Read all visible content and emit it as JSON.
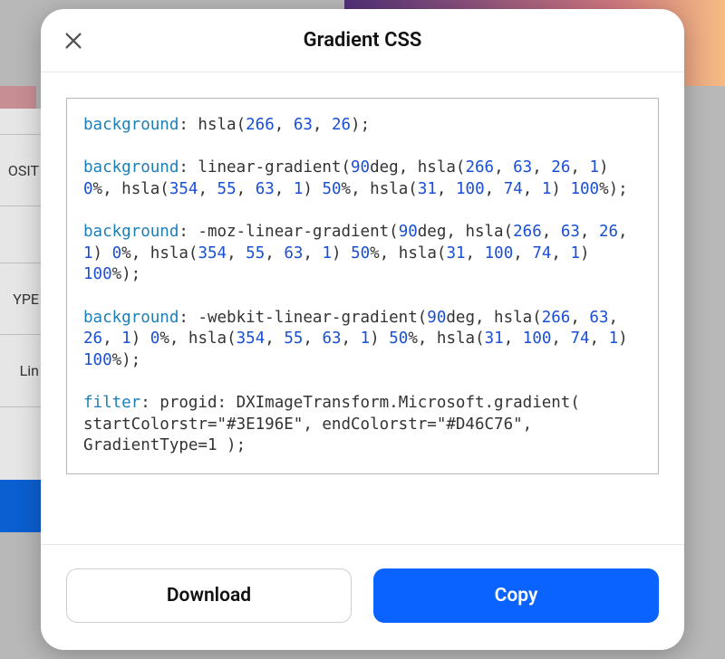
{
  "background": {
    "labels": {
      "osit": "OSIT",
      "ype": "YPE",
      "lin": "Lin"
    }
  },
  "modal": {
    "title": "Gradient CSS"
  },
  "code": {
    "lines": [
      [
        {
          "t": "background",
          "c": "prop"
        },
        {
          "t": ": hsla(",
          "c": ""
        },
        {
          "t": "266",
          "c": "num"
        },
        {
          "t": ", ",
          "c": ""
        },
        {
          "t": "63",
          "c": "num"
        },
        {
          "t": ", ",
          "c": ""
        },
        {
          "t": "26",
          "c": "num"
        },
        {
          "t": ");",
          "c": ""
        }
      ],
      [],
      [
        {
          "t": "background",
          "c": "prop"
        },
        {
          "t": ": linear-gradient(",
          "c": ""
        },
        {
          "t": "90",
          "c": "num"
        },
        {
          "t": "deg, hsla(",
          "c": ""
        },
        {
          "t": "266",
          "c": "num"
        },
        {
          "t": ", ",
          "c": ""
        },
        {
          "t": "63",
          "c": "num"
        },
        {
          "t": ", ",
          "c": ""
        },
        {
          "t": "26",
          "c": "num"
        },
        {
          "t": ", ",
          "c": ""
        },
        {
          "t": "1",
          "c": "num"
        },
        {
          "t": ") ",
          "c": ""
        },
        {
          "t": "0",
          "c": "num"
        },
        {
          "t": "%, hsla(",
          "c": ""
        },
        {
          "t": "354",
          "c": "num"
        },
        {
          "t": ", ",
          "c": ""
        },
        {
          "t": "55",
          "c": "num"
        },
        {
          "t": ", ",
          "c": ""
        },
        {
          "t": "63",
          "c": "num"
        },
        {
          "t": ", ",
          "c": ""
        },
        {
          "t": "1",
          "c": "num"
        },
        {
          "t": ") ",
          "c": ""
        },
        {
          "t": "50",
          "c": "num"
        },
        {
          "t": "%, hsla(",
          "c": ""
        },
        {
          "t": "31",
          "c": "num"
        },
        {
          "t": ", ",
          "c": ""
        },
        {
          "t": "100",
          "c": "num"
        },
        {
          "t": ", ",
          "c": ""
        },
        {
          "t": "74",
          "c": "num"
        },
        {
          "t": ", ",
          "c": ""
        },
        {
          "t": "1",
          "c": "num"
        },
        {
          "t": ") ",
          "c": ""
        },
        {
          "t": "100",
          "c": "num"
        },
        {
          "t": "%);",
          "c": ""
        }
      ],
      [],
      [
        {
          "t": "background",
          "c": "prop"
        },
        {
          "t": ": -moz-linear-gradient(",
          "c": ""
        },
        {
          "t": "90",
          "c": "num"
        },
        {
          "t": "deg, hsla(",
          "c": ""
        },
        {
          "t": "266",
          "c": "num"
        },
        {
          "t": ", ",
          "c": ""
        },
        {
          "t": "63",
          "c": "num"
        },
        {
          "t": ", ",
          "c": ""
        },
        {
          "t": "26",
          "c": "num"
        },
        {
          "t": ", ",
          "c": ""
        },
        {
          "t": "1",
          "c": "num"
        },
        {
          "t": ") ",
          "c": ""
        },
        {
          "t": "0",
          "c": "num"
        },
        {
          "t": "%, hsla(",
          "c": ""
        },
        {
          "t": "354",
          "c": "num"
        },
        {
          "t": ", ",
          "c": ""
        },
        {
          "t": "55",
          "c": "num"
        },
        {
          "t": ", ",
          "c": ""
        },
        {
          "t": "63",
          "c": "num"
        },
        {
          "t": ", ",
          "c": ""
        },
        {
          "t": "1",
          "c": "num"
        },
        {
          "t": ") ",
          "c": ""
        },
        {
          "t": "50",
          "c": "num"
        },
        {
          "t": "%, hsla(",
          "c": ""
        },
        {
          "t": "31",
          "c": "num"
        },
        {
          "t": ", ",
          "c": ""
        },
        {
          "t": "100",
          "c": "num"
        },
        {
          "t": ", ",
          "c": ""
        },
        {
          "t": "74",
          "c": "num"
        },
        {
          "t": ", ",
          "c": ""
        },
        {
          "t": "1",
          "c": "num"
        },
        {
          "t": ") ",
          "c": ""
        },
        {
          "t": "100",
          "c": "num"
        },
        {
          "t": "%);",
          "c": ""
        }
      ],
      [],
      [
        {
          "t": "background",
          "c": "prop"
        },
        {
          "t": ": -webkit-linear-gradient(",
          "c": ""
        },
        {
          "t": "90",
          "c": "num"
        },
        {
          "t": "deg, hsla(",
          "c": ""
        },
        {
          "t": "266",
          "c": "num"
        },
        {
          "t": ", ",
          "c": ""
        },
        {
          "t": "63",
          "c": "num"
        },
        {
          "t": ", ",
          "c": ""
        },
        {
          "t": "26",
          "c": "num"
        },
        {
          "t": ", ",
          "c": ""
        },
        {
          "t": "1",
          "c": "num"
        },
        {
          "t": ") ",
          "c": ""
        },
        {
          "t": "0",
          "c": "num"
        },
        {
          "t": "%, hsla(",
          "c": ""
        },
        {
          "t": "354",
          "c": "num"
        },
        {
          "t": ", ",
          "c": ""
        },
        {
          "t": "55",
          "c": "num"
        },
        {
          "t": ", ",
          "c": ""
        },
        {
          "t": "63",
          "c": "num"
        },
        {
          "t": ", ",
          "c": ""
        },
        {
          "t": "1",
          "c": "num"
        },
        {
          "t": ") ",
          "c": ""
        },
        {
          "t": "50",
          "c": "num"
        },
        {
          "t": "%, hsla(",
          "c": ""
        },
        {
          "t": "31",
          "c": "num"
        },
        {
          "t": ", ",
          "c": ""
        },
        {
          "t": "100",
          "c": "num"
        },
        {
          "t": ", ",
          "c": ""
        },
        {
          "t": "74",
          "c": "num"
        },
        {
          "t": ", ",
          "c": ""
        },
        {
          "t": "1",
          "c": "num"
        },
        {
          "t": ") ",
          "c": ""
        },
        {
          "t": "100",
          "c": "num"
        },
        {
          "t": "%);",
          "c": ""
        }
      ],
      [],
      [
        {
          "t": "filter",
          "c": "prop"
        },
        {
          "t": ": progid: DXImageTransform.Microsoft.gradient( startColorstr=\"#3E196E\", endColorstr=\"#D46C76\", GradientType=1 );",
          "c": ""
        }
      ]
    ]
  },
  "buttons": {
    "download": "Download",
    "copy": "Copy"
  }
}
